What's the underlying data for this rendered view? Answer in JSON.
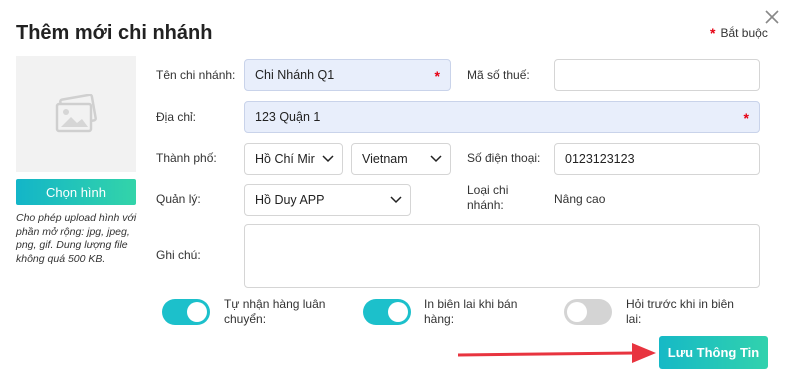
{
  "dialog": {
    "title": "Thêm mới chi nhánh",
    "required_note": "Bắt buộc",
    "required_marker": "*"
  },
  "image": {
    "placeholder_icon": "image-placeholder-icon",
    "choose_label": "Chọn hình",
    "upload_note": "Cho phép upload hình với phần mở rộng: jpg, jpeg, png, gif. Dung lượng file không quá 500 KB."
  },
  "form": {
    "branch_name": {
      "label": "Tên chi nhánh:",
      "value": "Chi Nhánh Q1"
    },
    "tax_code": {
      "label": "Mã số thuế:",
      "value": ""
    },
    "address": {
      "label": "Địa chỉ:",
      "value": "123 Quận 1"
    },
    "city": {
      "label": "Thành phố:",
      "value": "Hồ Chí Mir"
    },
    "country": {
      "value": "Vietnam"
    },
    "phone": {
      "label": "Số điện thoại:",
      "value": "0123123123"
    },
    "manager": {
      "label": "Quản lý:",
      "value": "Hồ Duy APP"
    },
    "branch_type": {
      "label": "Loại chi nhánh:",
      "value": "Nâng cao"
    },
    "note": {
      "label": "Ghi chú:",
      "value": ""
    }
  },
  "toggles": [
    {
      "label": "Tự nhận hàng luân chuyển:",
      "state": "on"
    },
    {
      "label": "In biên lai khi bán hàng:",
      "state": "on"
    },
    {
      "label": "Hỏi trước khi in biên lai:",
      "state": "off"
    }
  ],
  "actions": {
    "save_label": "Lưu Thông Tin"
  },
  "colors": {
    "accent": "#1cc0cb",
    "required": "#e60012",
    "annotation_arrow": "#e8343f",
    "highlight_field": "#e8eefb"
  }
}
